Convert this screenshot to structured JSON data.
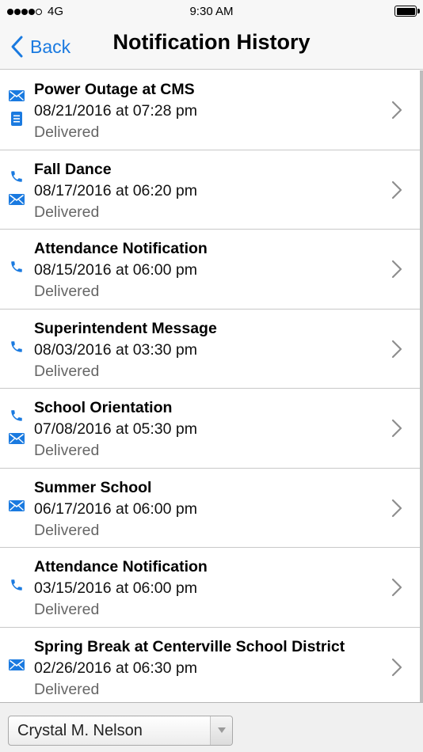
{
  "status_bar": {
    "carrier": "4G",
    "time": "9:30 AM"
  },
  "nav": {
    "back_label": "Back",
    "title": "Notification History"
  },
  "colors": {
    "accent": "#1a7ae0",
    "status_text": "#666666"
  },
  "notifications": [
    {
      "title": "Power Outage at CMS",
      "datetime": "08/21/2016 at 07:28 pm",
      "status": "Delivered",
      "channels": [
        "email-icon",
        "text-message-icon"
      ]
    },
    {
      "title": "Fall Dance",
      "datetime": "08/17/2016 at 06:20 pm",
      "status": "Delivered",
      "channels": [
        "phone-icon",
        "email-icon"
      ]
    },
    {
      "title": "Attendance Notification",
      "datetime": "08/15/2016 at 06:00 pm",
      "status": "Delivered",
      "channels": [
        "phone-icon"
      ]
    },
    {
      "title": "Superintendent Message",
      "datetime": "08/03/2016 at 03:30 pm",
      "status": "Delivered",
      "channels": [
        "phone-icon"
      ]
    },
    {
      "title": "School Orientation",
      "datetime": "07/08/2016 at 05:30 pm",
      "status": "Delivered",
      "channels": [
        "phone-icon",
        "email-icon"
      ]
    },
    {
      "title": "Summer School",
      "datetime": "06/17/2016 at 06:00 pm",
      "status": "Delivered",
      "channels": [
        "email-icon"
      ]
    },
    {
      "title": "Attendance Notification",
      "datetime": "03/15/2016 at 06:00 pm",
      "status": "Delivered",
      "channels": [
        "phone-icon"
      ]
    },
    {
      "title": "Spring Break at Centerville School District",
      "datetime": "02/26/2016 at 06:30 pm",
      "status": "Delivered",
      "channels": [
        "email-icon"
      ]
    }
  ],
  "user_selector": {
    "selected": "Crystal M. Nelson"
  }
}
